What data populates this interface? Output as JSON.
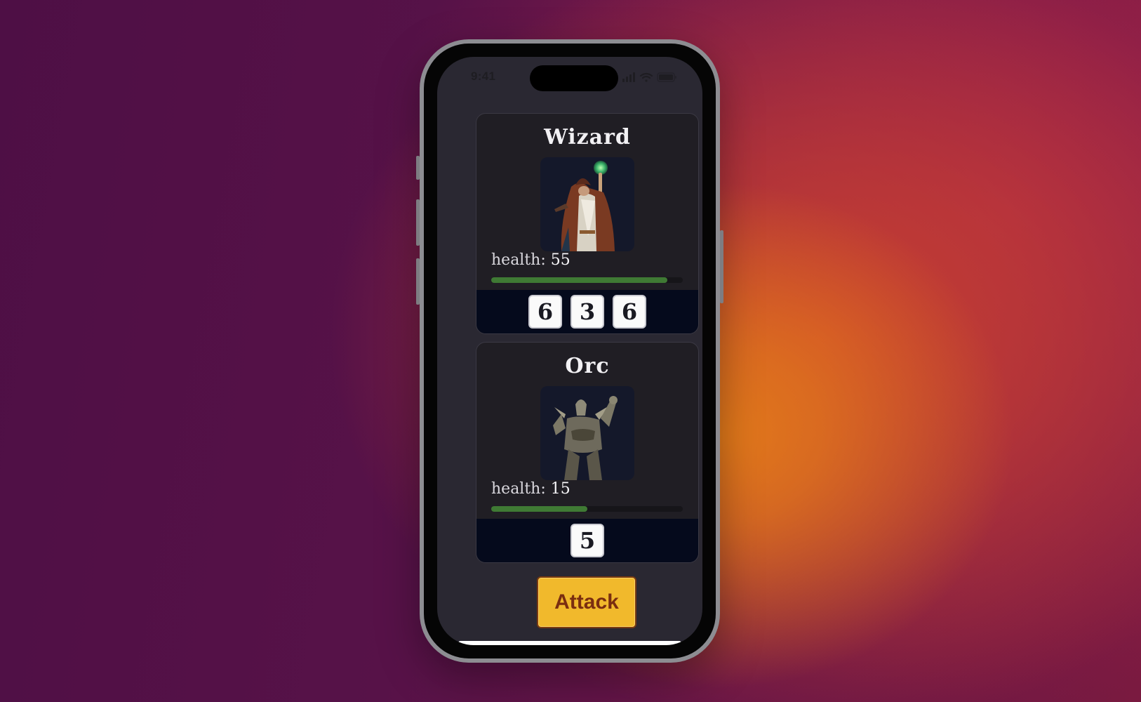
{
  "status_bar": {
    "time": "9:41"
  },
  "player": {
    "name": "Wizard",
    "health_label": "health:",
    "health_value": "55",
    "health_fraction": 0.92,
    "dice": [
      "6",
      "3",
      "6"
    ],
    "portrait_icon": "wizard-figure"
  },
  "enemy": {
    "name": "Orc",
    "health_label": "health:",
    "health_value": "15",
    "health_fraction": 0.5,
    "dice": [
      "5"
    ],
    "portrait_icon": "orc-figure"
  },
  "actions": {
    "attack_label": "Attack"
  },
  "colors": {
    "health_bar": "#3f7a34",
    "attack_button": "#f1b92c",
    "card_background": "#201e24",
    "dice_strip": "#050a1c"
  }
}
